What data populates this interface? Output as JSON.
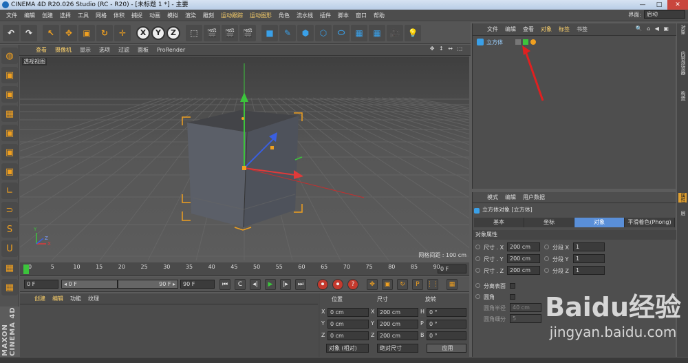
{
  "title": "CINEMA 4D R20.026 Studio (RC - R20) - [未标题 1 *] - 主要",
  "window_buttons": [
    "—",
    "□",
    "✕"
  ],
  "menu": [
    "文件",
    "编辑",
    "创建",
    "选择",
    "工具",
    "网格",
    "体积",
    "捕捉",
    "动画",
    "模拟",
    "渲染",
    "雕刻",
    "运动跟踪",
    "运动图形",
    "角色",
    "流水线",
    "插件",
    "脚本",
    "窗口",
    "帮助"
  ],
  "menu_highlight": [
    12,
    13
  ],
  "layout": {
    "label": "界面:",
    "value": "启动"
  },
  "toolbar": [
    "↶",
    "↷",
    "↖",
    "✥",
    "▣",
    "↻",
    "✛",
    "X",
    "Y",
    "Z",
    "⬚",
    "🎬",
    "🎬",
    "🎬",
    "■",
    "✎",
    "⬢",
    "⬡",
    "⬭",
    "▦",
    "▦",
    "🎥",
    "💡"
  ],
  "leftbar_icons": [
    "◍",
    "▣",
    "▣",
    "▦",
    "▣",
    "▣",
    "▣",
    "∟",
    "⊃",
    "S",
    "U",
    "▦",
    "▦"
  ],
  "viewport": {
    "menu": [
      "查看",
      "摄像机",
      "显示",
      "选项",
      "过滤",
      "面板",
      "ProRender"
    ],
    "controls": "✥ ↕ ↔ ⬚",
    "label": "透视视图",
    "grid_text": "网格间距 : 100 cm",
    "axis_labels": [
      "Y",
      "Z",
      "X"
    ]
  },
  "timeline": {
    "ticks": [
      "0",
      "5",
      "10",
      "15",
      "20",
      "25",
      "30",
      "35",
      "40",
      "45",
      "50",
      "55",
      "60",
      "65",
      "70",
      "75",
      "80",
      "85",
      "90"
    ],
    "current": "0 F"
  },
  "transport": {
    "start": "0 F",
    "range_start": "◂ 0 F",
    "range_end": "90 F ▸",
    "end": "90 F",
    "buttons": [
      "⏮",
      "C",
      "◂|",
      "▶",
      "|▸",
      "⏭",
      "⏺",
      "⏺",
      "?",
      "✥",
      "▣",
      "↻",
      "P",
      "⋮⋮",
      "▦"
    ]
  },
  "material": {
    "menu": [
      "创建",
      "编辑",
      "功能",
      "纹理"
    ]
  },
  "coords": {
    "headers": [
      "位置",
      "尺寸",
      "旋转"
    ],
    "rows": [
      {
        "a": "X",
        "pos": "0 cm",
        "b": "X",
        "size": "200 cm",
        "c": "H",
        "rot": "0 °"
      },
      {
        "a": "Y",
        "pos": "0 cm",
        "b": "Y",
        "size": "200 cm",
        "c": "P",
        "rot": "0 °"
      },
      {
        "a": "Z",
        "pos": "0 cm",
        "b": "Z",
        "size": "200 cm",
        "c": "B",
        "rot": "0 °"
      }
    ],
    "mode": "对象 (相对)",
    "size_mode": "绝对尺寸",
    "apply": "应用"
  },
  "objects": {
    "menu": [
      "文件",
      "编辑",
      "查看",
      "对象",
      "标签",
      "书签"
    ],
    "item": "立方体",
    "tool_icons": "🔍 ⌂ ◀ ▣"
  },
  "attributes": {
    "menu": [
      "模式",
      "编辑",
      "用户数据"
    ],
    "title": "立方体对象 [立方体]",
    "tabs": [
      "基本",
      "坐标",
      "对象",
      "平滑着色(Phong)"
    ],
    "active_tab": 2,
    "section": "对象属性",
    "rows": [
      {
        "label": "尺寸 . X",
        "value": "200 cm",
        "seg": "分段 X",
        "segv": "1"
      },
      {
        "label": "尺寸 . Y",
        "value": "200 cm",
        "seg": "分段 Y",
        "segv": "1"
      },
      {
        "label": "尺寸 . Z",
        "value": "200 cm",
        "seg": "分段 Z",
        "segv": "1"
      }
    ],
    "sep_faces": "分离表面",
    "fillet": "圆角",
    "fillet_radius": {
      "label": "圆角半径",
      "value": "40 cm"
    },
    "fillet_sub": {
      "label": "圆角细分",
      "value": "5"
    }
  },
  "right_tabs": [
    "对象",
    "内容浏览器",
    "构造",
    "属性",
    "层"
  ],
  "active_right_tab": 3,
  "branding": {
    "vertical": "MAXON CINEMA 4D"
  },
  "watermark": {
    "big": "Baidu经验",
    "small": "jingyan.baidu.com"
  }
}
